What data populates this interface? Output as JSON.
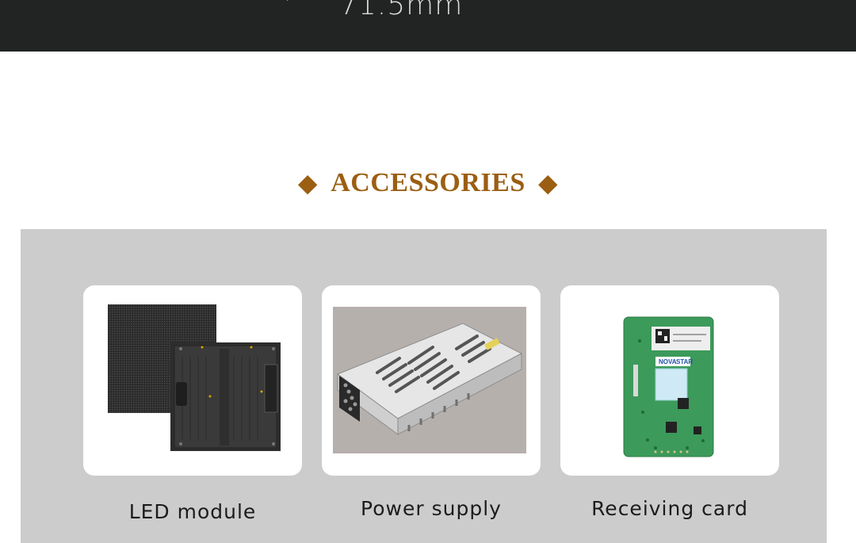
{
  "header": {
    "dimension_text": "71.5mm"
  },
  "section": {
    "title": "ACCESSORIES",
    "left_ornament": "◆",
    "right_ornament": "◆",
    "title_color": "#9b5e12"
  },
  "accessories": [
    {
      "label": "LED module",
      "icon": "led-module-photo"
    },
    {
      "label": "Power supply",
      "icon": "power-supply-photo"
    },
    {
      "label": "Receiving card",
      "icon": "receiving-card-photo"
    }
  ],
  "receiving_card_brand": {
    "nova": "NOVA",
    "star": "STAR"
  }
}
